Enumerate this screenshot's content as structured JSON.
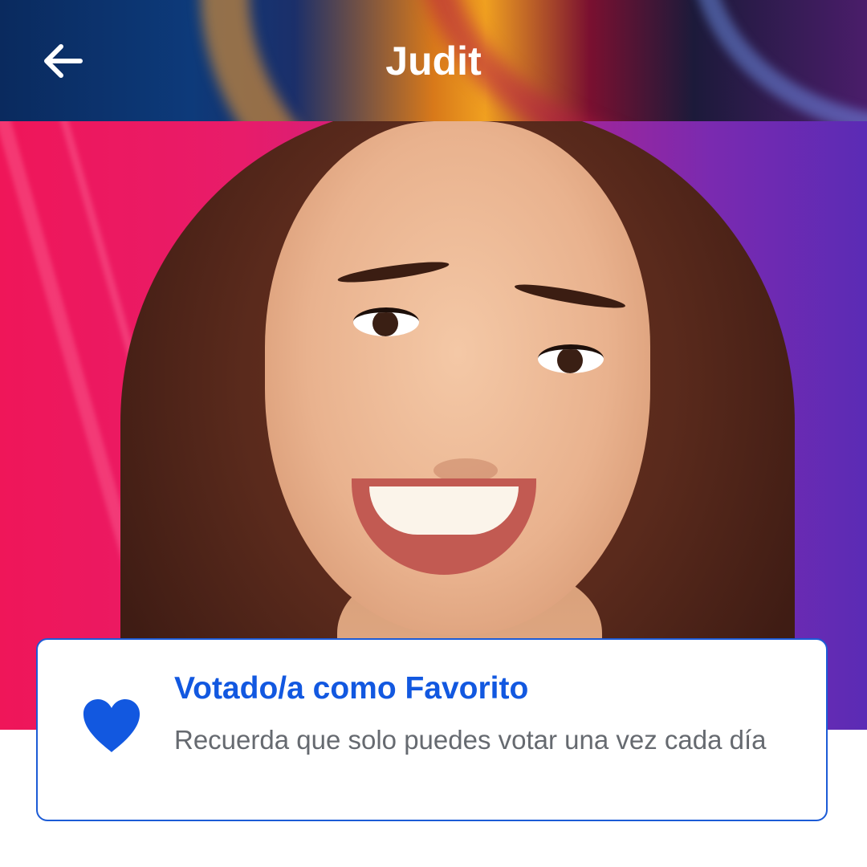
{
  "header": {
    "title": "Judit",
    "back_icon": "arrow-left-icon"
  },
  "hero": {
    "image": "contestant-portrait-photo"
  },
  "favorite_card": {
    "icon": "heart-icon",
    "title": "Votado/a como Favorito",
    "subtitle": "Recuerda que solo puedes votar una vez cada día"
  },
  "colors": {
    "accent": "#1258e0",
    "card_border": "#1c5bd6",
    "subtitle_text": "#666a70",
    "hero_left": "#ef1659",
    "hero_right": "#5b2bb5"
  }
}
